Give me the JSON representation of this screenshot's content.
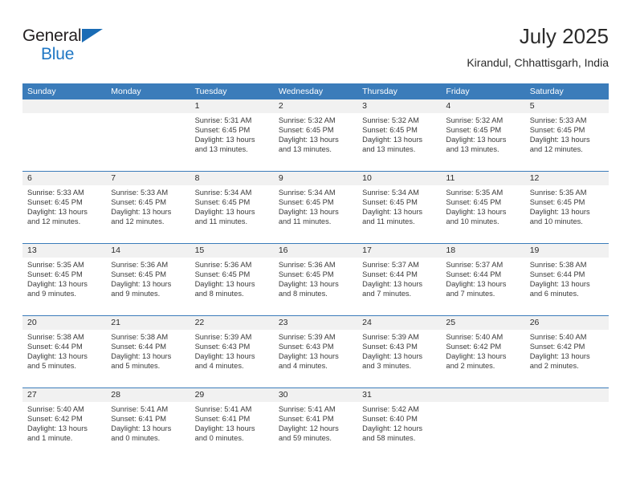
{
  "brand": {
    "line1": "General",
    "line2": "Blue",
    "accent_color": "#1a6cb5"
  },
  "header": {
    "title": "July 2025",
    "location": "Kirandul, Chhattisgarh, India"
  },
  "theme": {
    "header_row_bg": "#3b7cba",
    "day_number_bg": "#f1f1f1",
    "grid_line": "#3b7cba"
  },
  "weekday_headers": [
    "Sunday",
    "Monday",
    "Tuesday",
    "Wednesday",
    "Thursday",
    "Friday",
    "Saturday"
  ],
  "weeks": [
    [
      {
        "day": "",
        "sunrise": "",
        "sunset": "",
        "daylight_line1": "",
        "daylight_line2": "",
        "empty": true
      },
      {
        "day": "",
        "sunrise": "",
        "sunset": "",
        "daylight_line1": "",
        "daylight_line2": "",
        "empty": true
      },
      {
        "day": "1",
        "sunrise": "Sunrise: 5:31 AM",
        "sunset": "Sunset: 6:45 PM",
        "daylight_line1": "Daylight: 13 hours",
        "daylight_line2": "and 13 minutes."
      },
      {
        "day": "2",
        "sunrise": "Sunrise: 5:32 AM",
        "sunset": "Sunset: 6:45 PM",
        "daylight_line1": "Daylight: 13 hours",
        "daylight_line2": "and 13 minutes."
      },
      {
        "day": "3",
        "sunrise": "Sunrise: 5:32 AM",
        "sunset": "Sunset: 6:45 PM",
        "daylight_line1": "Daylight: 13 hours",
        "daylight_line2": "and 13 minutes."
      },
      {
        "day": "4",
        "sunrise": "Sunrise: 5:32 AM",
        "sunset": "Sunset: 6:45 PM",
        "daylight_line1": "Daylight: 13 hours",
        "daylight_line2": "and 13 minutes."
      },
      {
        "day": "5",
        "sunrise": "Sunrise: 5:33 AM",
        "sunset": "Sunset: 6:45 PM",
        "daylight_line1": "Daylight: 13 hours",
        "daylight_line2": "and 12 minutes."
      }
    ],
    [
      {
        "day": "6",
        "sunrise": "Sunrise: 5:33 AM",
        "sunset": "Sunset: 6:45 PM",
        "daylight_line1": "Daylight: 13 hours",
        "daylight_line2": "and 12 minutes."
      },
      {
        "day": "7",
        "sunrise": "Sunrise: 5:33 AM",
        "sunset": "Sunset: 6:45 PM",
        "daylight_line1": "Daylight: 13 hours",
        "daylight_line2": "and 12 minutes."
      },
      {
        "day": "8",
        "sunrise": "Sunrise: 5:34 AM",
        "sunset": "Sunset: 6:45 PM",
        "daylight_line1": "Daylight: 13 hours",
        "daylight_line2": "and 11 minutes."
      },
      {
        "day": "9",
        "sunrise": "Sunrise: 5:34 AM",
        "sunset": "Sunset: 6:45 PM",
        "daylight_line1": "Daylight: 13 hours",
        "daylight_line2": "and 11 minutes."
      },
      {
        "day": "10",
        "sunrise": "Sunrise: 5:34 AM",
        "sunset": "Sunset: 6:45 PM",
        "daylight_line1": "Daylight: 13 hours",
        "daylight_line2": "and 11 minutes."
      },
      {
        "day": "11",
        "sunrise": "Sunrise: 5:35 AM",
        "sunset": "Sunset: 6:45 PM",
        "daylight_line1": "Daylight: 13 hours",
        "daylight_line2": "and 10 minutes."
      },
      {
        "day": "12",
        "sunrise": "Sunrise: 5:35 AM",
        "sunset": "Sunset: 6:45 PM",
        "daylight_line1": "Daylight: 13 hours",
        "daylight_line2": "and 10 minutes."
      }
    ],
    [
      {
        "day": "13",
        "sunrise": "Sunrise: 5:35 AM",
        "sunset": "Sunset: 6:45 PM",
        "daylight_line1": "Daylight: 13 hours",
        "daylight_line2": "and 9 minutes."
      },
      {
        "day": "14",
        "sunrise": "Sunrise: 5:36 AM",
        "sunset": "Sunset: 6:45 PM",
        "daylight_line1": "Daylight: 13 hours",
        "daylight_line2": "and 9 minutes."
      },
      {
        "day": "15",
        "sunrise": "Sunrise: 5:36 AM",
        "sunset": "Sunset: 6:45 PM",
        "daylight_line1": "Daylight: 13 hours",
        "daylight_line2": "and 8 minutes."
      },
      {
        "day": "16",
        "sunrise": "Sunrise: 5:36 AM",
        "sunset": "Sunset: 6:45 PM",
        "daylight_line1": "Daylight: 13 hours",
        "daylight_line2": "and 8 minutes."
      },
      {
        "day": "17",
        "sunrise": "Sunrise: 5:37 AM",
        "sunset": "Sunset: 6:44 PM",
        "daylight_line1": "Daylight: 13 hours",
        "daylight_line2": "and 7 minutes."
      },
      {
        "day": "18",
        "sunrise": "Sunrise: 5:37 AM",
        "sunset": "Sunset: 6:44 PM",
        "daylight_line1": "Daylight: 13 hours",
        "daylight_line2": "and 7 minutes."
      },
      {
        "day": "19",
        "sunrise": "Sunrise: 5:38 AM",
        "sunset": "Sunset: 6:44 PM",
        "daylight_line1": "Daylight: 13 hours",
        "daylight_line2": "and 6 minutes."
      }
    ],
    [
      {
        "day": "20",
        "sunrise": "Sunrise: 5:38 AM",
        "sunset": "Sunset: 6:44 PM",
        "daylight_line1": "Daylight: 13 hours",
        "daylight_line2": "and 5 minutes."
      },
      {
        "day": "21",
        "sunrise": "Sunrise: 5:38 AM",
        "sunset": "Sunset: 6:44 PM",
        "daylight_line1": "Daylight: 13 hours",
        "daylight_line2": "and 5 minutes."
      },
      {
        "day": "22",
        "sunrise": "Sunrise: 5:39 AM",
        "sunset": "Sunset: 6:43 PM",
        "daylight_line1": "Daylight: 13 hours",
        "daylight_line2": "and 4 minutes."
      },
      {
        "day": "23",
        "sunrise": "Sunrise: 5:39 AM",
        "sunset": "Sunset: 6:43 PM",
        "daylight_line1": "Daylight: 13 hours",
        "daylight_line2": "and 4 minutes."
      },
      {
        "day": "24",
        "sunrise": "Sunrise: 5:39 AM",
        "sunset": "Sunset: 6:43 PM",
        "daylight_line1": "Daylight: 13 hours",
        "daylight_line2": "and 3 minutes."
      },
      {
        "day": "25",
        "sunrise": "Sunrise: 5:40 AM",
        "sunset": "Sunset: 6:42 PM",
        "daylight_line1": "Daylight: 13 hours",
        "daylight_line2": "and 2 minutes."
      },
      {
        "day": "26",
        "sunrise": "Sunrise: 5:40 AM",
        "sunset": "Sunset: 6:42 PM",
        "daylight_line1": "Daylight: 13 hours",
        "daylight_line2": "and 2 minutes."
      }
    ],
    [
      {
        "day": "27",
        "sunrise": "Sunrise: 5:40 AM",
        "sunset": "Sunset: 6:42 PM",
        "daylight_line1": "Daylight: 13 hours",
        "daylight_line2": "and 1 minute."
      },
      {
        "day": "28",
        "sunrise": "Sunrise: 5:41 AM",
        "sunset": "Sunset: 6:41 PM",
        "daylight_line1": "Daylight: 13 hours",
        "daylight_line2": "and 0 minutes."
      },
      {
        "day": "29",
        "sunrise": "Sunrise: 5:41 AM",
        "sunset": "Sunset: 6:41 PM",
        "daylight_line1": "Daylight: 13 hours",
        "daylight_line2": "and 0 minutes."
      },
      {
        "day": "30",
        "sunrise": "Sunrise: 5:41 AM",
        "sunset": "Sunset: 6:41 PM",
        "daylight_line1": "Daylight: 12 hours",
        "daylight_line2": "and 59 minutes."
      },
      {
        "day": "31",
        "sunrise": "Sunrise: 5:42 AM",
        "sunset": "Sunset: 6:40 PM",
        "daylight_line1": "Daylight: 12 hours",
        "daylight_line2": "and 58 minutes."
      },
      {
        "day": "",
        "sunrise": "",
        "sunset": "",
        "daylight_line1": "",
        "daylight_line2": "",
        "empty": true
      },
      {
        "day": "",
        "sunrise": "",
        "sunset": "",
        "daylight_line1": "",
        "daylight_line2": "",
        "empty": true
      }
    ]
  ]
}
